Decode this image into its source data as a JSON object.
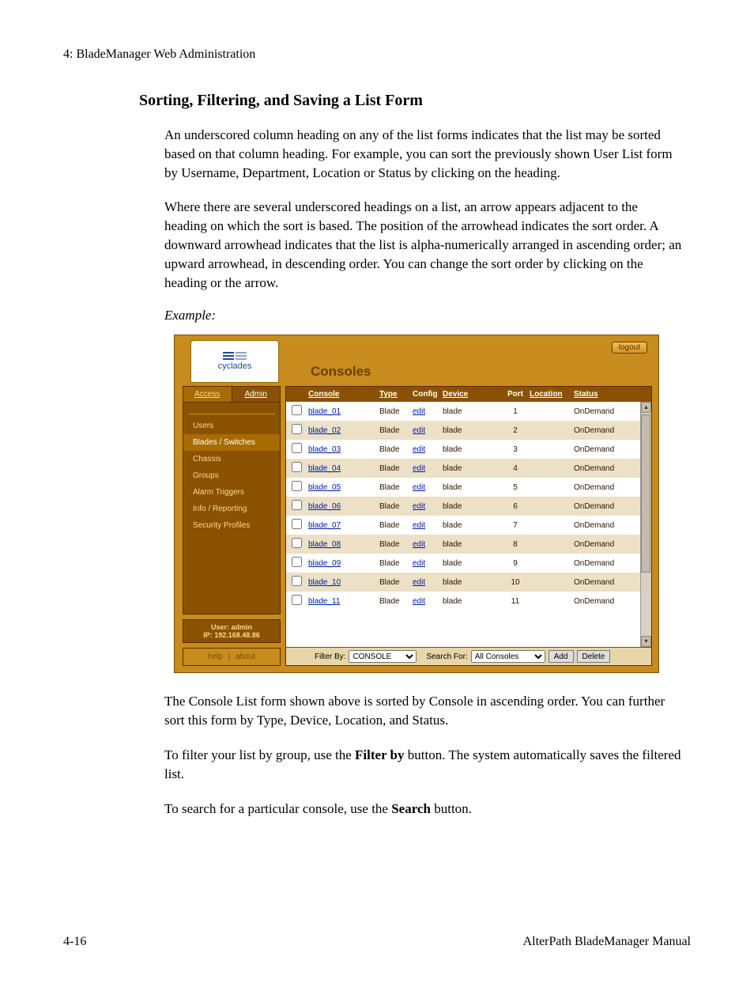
{
  "doc": {
    "chapter_head": "4: BladeManager Web Administration",
    "section_title": "Sorting, Filtering, and Saving a List Form",
    "para1": "An underscored column heading on any of the list forms indicates that the list may be sorted based on that column heading. For example, you can sort the previously shown User List form by Username, Department, Location or Status by clicking on the heading.",
    "para2": "Where there are several underscored headings on a list, an arrow appears adjacent to the heading on which the sort is based. The position of the arrowhead indicates the sort order. A downward arrowhead indicates that the list is alpha-numerically arranged in ascending order; an upward arrowhead, in descending order. You can change the sort order by clicking on the heading or the arrow.",
    "example_label": "Example:",
    "para3_a": "The Console List form shown above is sorted by Console in ascending order. You can further sort this form by Type, Device, Location, and Status.",
    "para4_lead": "To filter your list by group, use the ",
    "para4_bold": "Filter by",
    "para4_tail": " button. The system automatically saves the filtered list.",
    "para5_lead": "To search for a particular console, use the ",
    "para5_bold": "Search",
    "para5_tail": " button.",
    "footer_left": "4-16",
    "footer_right": "AlterPath BladeManager Manual"
  },
  "app": {
    "brand": "cyclades",
    "title": "Consoles",
    "logout_label": "logout",
    "tabs": {
      "access": "Access",
      "admin": "Admin"
    },
    "nav": {
      "users": "Users",
      "blades": "Blades / Switches",
      "chassis": "Chassis",
      "groups": "Groups",
      "alarm": "Alarm Triggers",
      "info": "Info / Reporting",
      "security": "Security Profiles"
    },
    "userbox_line1": "User: admin",
    "userbox_line2": "IP: 192.168.48.86",
    "help_label": "help",
    "help_sep": "|",
    "about_label": "about",
    "columns": {
      "console": "Console",
      "type": "Type",
      "config": "Config",
      "device": "Device",
      "port": "Port",
      "location": "Location",
      "status": "Status"
    },
    "edit_label": "edit",
    "rows": [
      {
        "name": "blade_01",
        "type": "Blade",
        "device": "blade",
        "port": "1",
        "status": "OnDemand"
      },
      {
        "name": "blade_02",
        "type": "Blade",
        "device": "blade",
        "port": "2",
        "status": "OnDemand"
      },
      {
        "name": "blade_03",
        "type": "Blade",
        "device": "blade",
        "port": "3",
        "status": "OnDemand"
      },
      {
        "name": "blade_04",
        "type": "Blade",
        "device": "blade",
        "port": "4",
        "status": "OnDemand"
      },
      {
        "name": "blade_05",
        "type": "Blade",
        "device": "blade",
        "port": "5",
        "status": "OnDemand"
      },
      {
        "name": "blade_06",
        "type": "Blade",
        "device": "blade",
        "port": "6",
        "status": "OnDemand"
      },
      {
        "name": "blade_07",
        "type": "Blade",
        "device": "blade",
        "port": "7",
        "status": "OnDemand"
      },
      {
        "name": "blade_08",
        "type": "Blade",
        "device": "blade",
        "port": "8",
        "status": "OnDemand"
      },
      {
        "name": "blade_09",
        "type": "Blade",
        "device": "blade",
        "port": "9",
        "status": "OnDemand"
      },
      {
        "name": "blade_10",
        "type": "Blade",
        "device": "blade",
        "port": "10",
        "status": "OnDemand"
      },
      {
        "name": "blade_11",
        "type": "Blade",
        "device": "blade",
        "port": "11",
        "status": "OnDemand"
      }
    ],
    "filter": {
      "filter_by_label": "Filter By:",
      "filter_by_value": "CONSOLE",
      "search_for_label": "Search For:",
      "search_for_value": "All Consoles",
      "add_label": "Add",
      "delete_label": "Delete"
    }
  }
}
